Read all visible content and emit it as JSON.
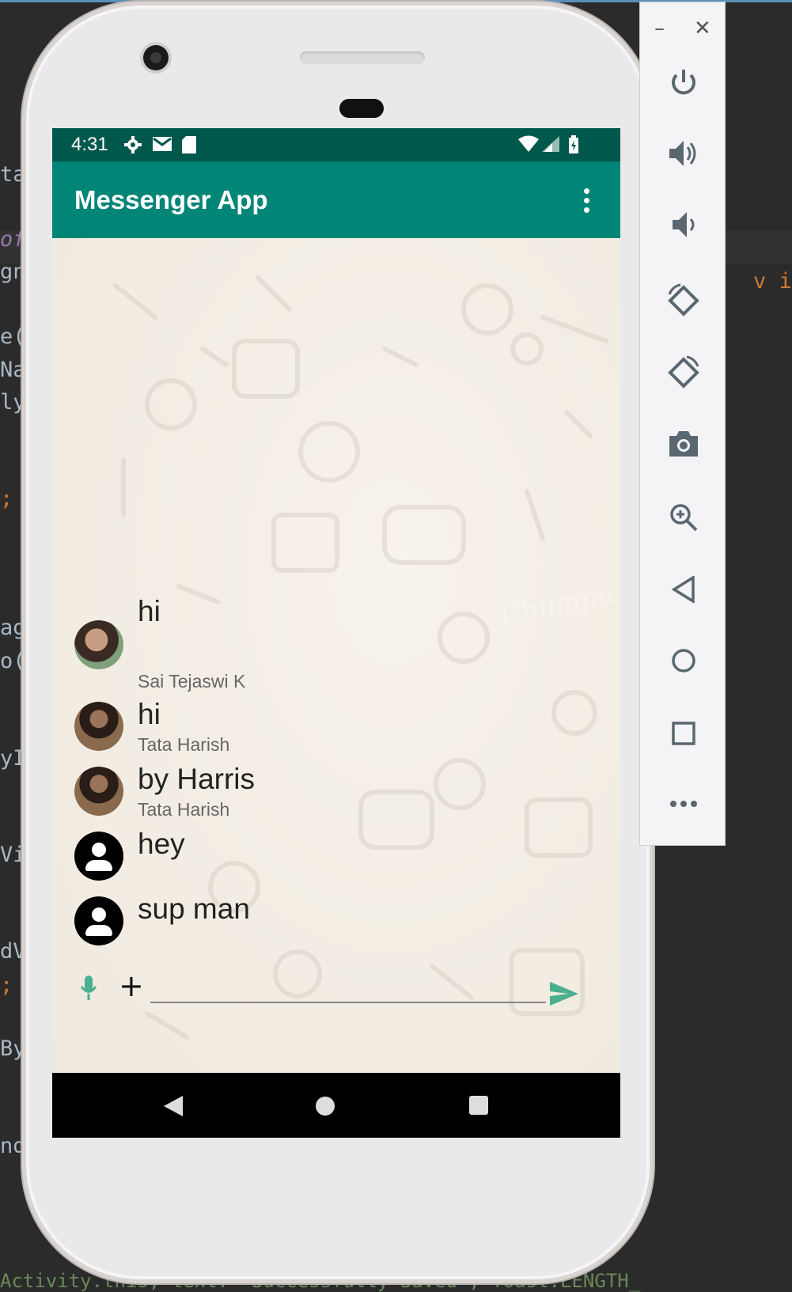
{
  "ide": {
    "left_fragments": [
      "ta",
      "of",
      "gn",
      "e(",
      "Na",
      "ly",
      ";",
      "ag",
      "o(",
      "yI",
      "Vi",
      "dV",
      ";",
      "By",
      "nd"
    ],
    "right_fragment": "v  is)",
    "bottom_line": "  Activity.this,  text: \"Successfully Saved\",  Toast.LENGTH_"
  },
  "status_bar": {
    "time": "4:31",
    "icons": [
      "gear-icon",
      "gmail-icon",
      "sd-card-icon",
      "wifi-icon",
      "signal-icon",
      "battery-icon"
    ]
  },
  "app_bar": {
    "title": "Messenger App",
    "menu_icon": "overflow-menu-icon"
  },
  "messages": [
    {
      "text": "hi",
      "sender": "Sai Tejaswi K",
      "avatar": "photo"
    },
    {
      "text": "hi",
      "sender": "Tata Harish",
      "avatar": "photo"
    },
    {
      "text": "by Harris",
      "sender": "Tata Harish",
      "avatar": "photo"
    },
    {
      "text": "hey",
      "sender": "",
      "avatar": "default"
    },
    {
      "text": "sup man",
      "sender": "",
      "avatar": "default"
    }
  ],
  "composer": {
    "mic_icon": "mic-icon",
    "plus_label": "+",
    "input_value": "",
    "input_placeholder": "",
    "send_icon": "send-icon"
  },
  "nav_bar": {
    "back": "back-icon",
    "home": "home-icon",
    "recents": "recents-icon"
  },
  "emulator_toolbar": {
    "minimize": "–",
    "close": "✕",
    "buttons": [
      "power-icon",
      "volume-up-icon",
      "volume-down-icon",
      "rotate-left-icon",
      "rotate-right-icon",
      "camera-icon",
      "zoom-icon",
      "back-icon",
      "home-icon",
      "overview-icon",
      "more-icon"
    ]
  },
  "colors": {
    "app_bar": "#008577",
    "status_bar": "#00574b",
    "accent": "#4caf8f"
  }
}
